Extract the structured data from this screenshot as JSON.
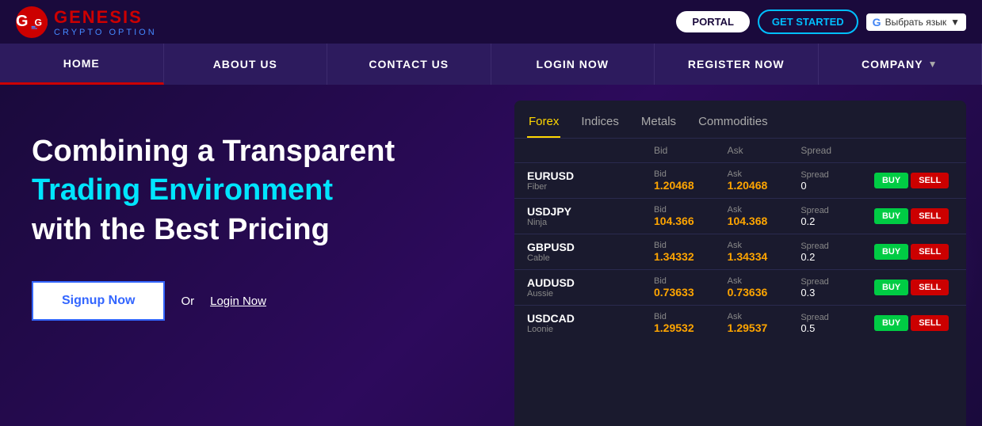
{
  "logo": {
    "icon_text": "G",
    "genesis": "GENESIS",
    "crypto_option": "CRYPTO OPTION"
  },
  "top_bar": {
    "portal_label": "PORTAL",
    "get_started_label": "GET STARTED",
    "translate_label": "Выбрать язык"
  },
  "nav": {
    "items": [
      {
        "id": "home",
        "label": "HOME"
      },
      {
        "id": "about",
        "label": "ABOUT US"
      },
      {
        "id": "contact",
        "label": "CONTACT US"
      },
      {
        "id": "login",
        "label": "LOGIN NOW"
      },
      {
        "id": "register",
        "label": "REGISTER NOW"
      },
      {
        "id": "company",
        "label": "COMPANY"
      }
    ]
  },
  "hero": {
    "title_line1": "Combining a Transparent",
    "title_line2": "Trading Environment",
    "title_line3": "with the Best Pricing",
    "signup_label": "Signup Now",
    "or_label": "Or",
    "login_label": "Login Now"
  },
  "trading": {
    "tabs": [
      {
        "id": "forex",
        "label": "Forex",
        "active": true
      },
      {
        "id": "indices",
        "label": "Indices",
        "active": false
      },
      {
        "id": "metals",
        "label": "Metals",
        "active": false
      },
      {
        "id": "commodities",
        "label": "Commodities",
        "active": false
      }
    ],
    "headers": {
      "pair": "",
      "bid": "Bid",
      "ask": "Ask",
      "spread": "Spread",
      "actions": ""
    },
    "rows": [
      {
        "pair": "EURUSD",
        "nickname": "Fiber",
        "bid": "1.20468",
        "ask": "1.20468",
        "spread": "0"
      },
      {
        "pair": "USDJPY",
        "nickname": "Ninja",
        "bid": "104.366",
        "ask": "104.368",
        "spread": "0.2"
      },
      {
        "pair": "GBPUSD",
        "nickname": "Cable",
        "bid": "1.34332",
        "ask": "1.34334",
        "spread": "0.2"
      },
      {
        "pair": "AUDUSD",
        "nickname": "Aussie",
        "bid": "0.73633",
        "ask": "0.73636",
        "spread": "0.3"
      },
      {
        "pair": "USDCAD",
        "nickname": "Loonie",
        "bid": "1.29532",
        "ask": "1.29537",
        "spread": "0.5"
      }
    ],
    "buy_label": "BUY",
    "sell_label": "SELL"
  }
}
